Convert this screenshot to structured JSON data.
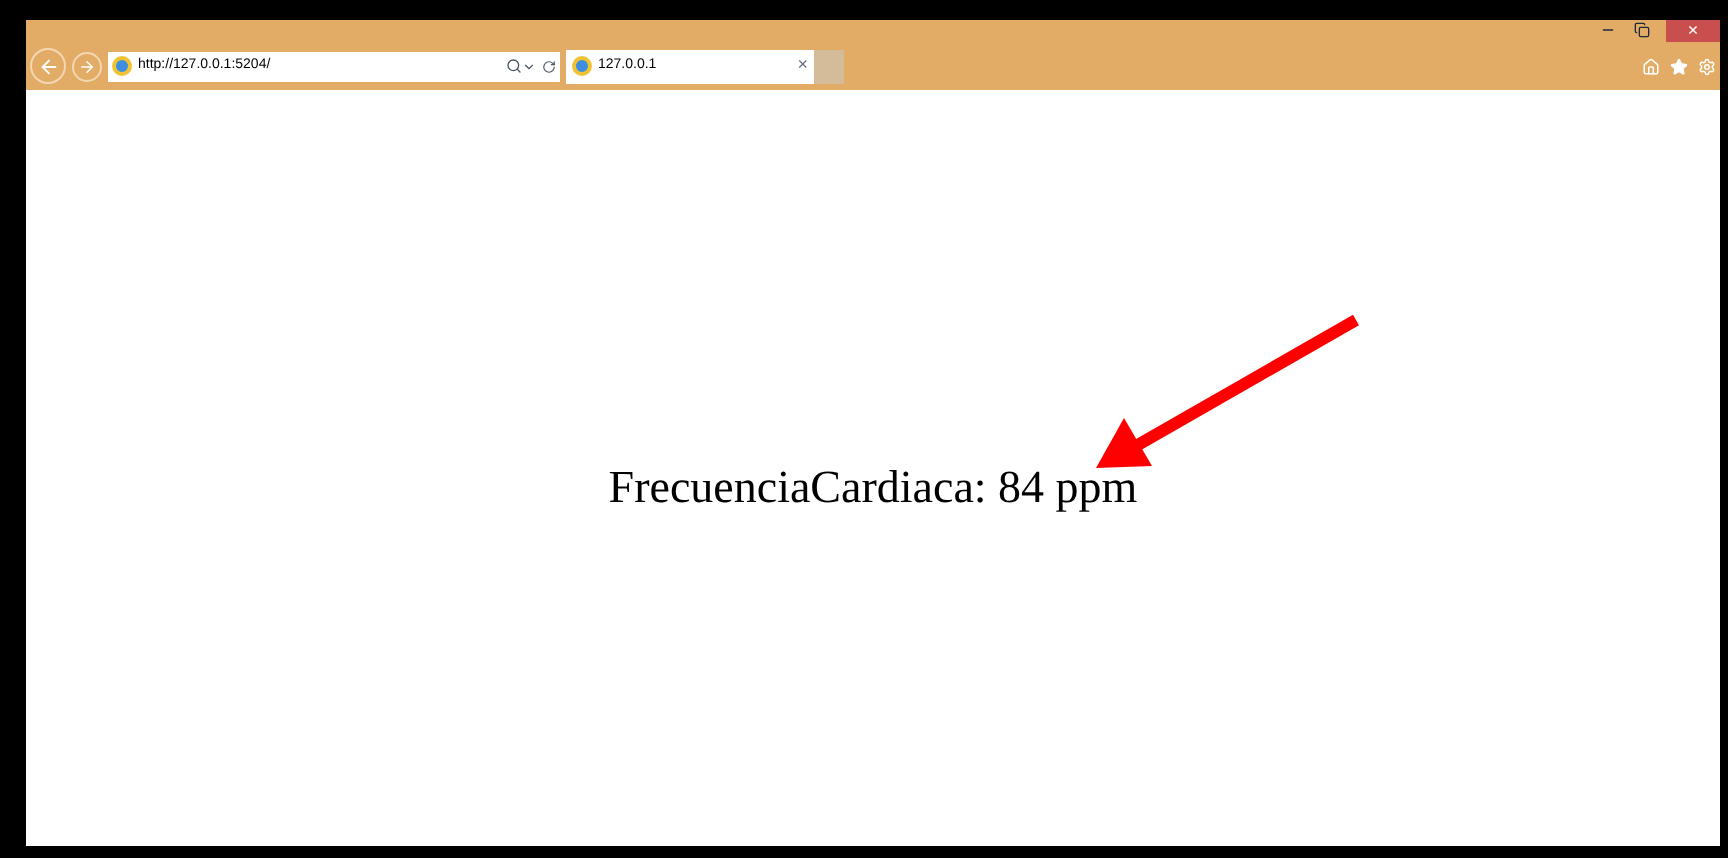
{
  "browser": {
    "address": "http://127.0.0.1:5204/",
    "tabs": [
      {
        "title": "127.0.0.1",
        "close": "×",
        "selected": true
      }
    ],
    "close_window": "×"
  },
  "page": {
    "reading": "FrecuenciaCardiaca: 84 ppm"
  }
}
